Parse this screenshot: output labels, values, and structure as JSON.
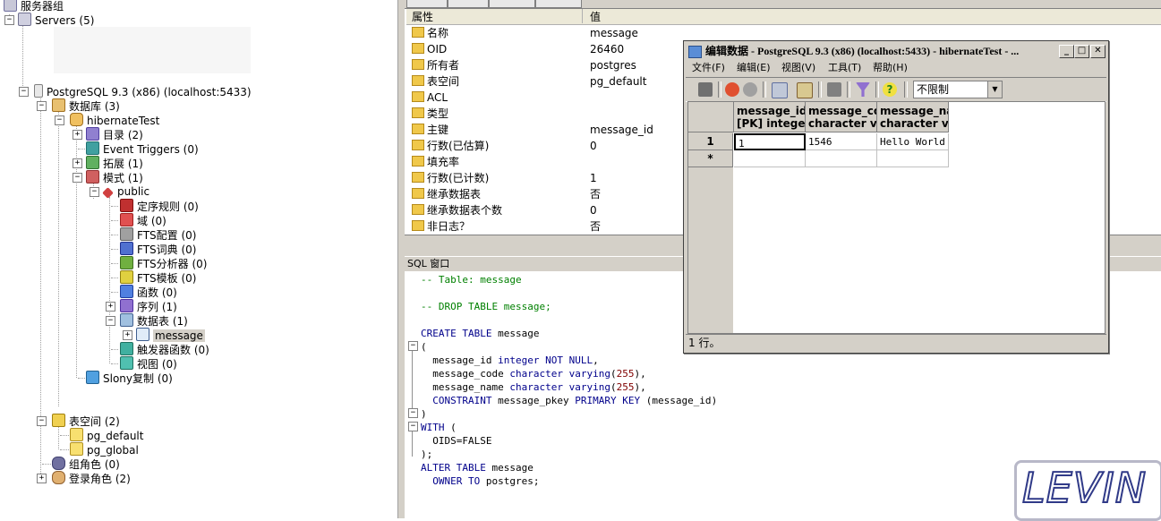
{
  "tree": {
    "server_group": "服务器组",
    "servers": "Servers (5)",
    "server": "PostgreSQL 9.3 (x86) (localhost:5433)",
    "databases": "数据库 (3)",
    "db": "hibernateTest",
    "catalogs": "目录 (2)",
    "event_triggers": "Event Triggers (0)",
    "extensions": "拓展 (1)",
    "schemas": "模式 (1)",
    "schema_public": "public",
    "collations": "定序规则 (0)",
    "domains": "域 (0)",
    "fts_config": "FTS配置 (0)",
    "fts_dict": "FTS词典 (0)",
    "fts_parser": "FTS分析器 (0)",
    "fts_template": "FTS模板 (0)",
    "functions": "函数 (0)",
    "sequences": "序列 (1)",
    "tables": "数据表 (1)",
    "table_message": "message",
    "trigger_functions": "触发器函数 (0)",
    "views": "视图 (0)",
    "slony": "Slony复制 (0)",
    "tablespaces": "表空间 (2)",
    "pg_default": "pg_default",
    "pg_global": "pg_global",
    "group_roles": "组角色 (0)",
    "login_roles": "登录角色 (2)"
  },
  "props": {
    "col_property": "属性",
    "col_value": "值",
    "rows": [
      {
        "k": "名称",
        "v": "message"
      },
      {
        "k": "OID",
        "v": "26460"
      },
      {
        "k": "所有者",
        "v": "postgres"
      },
      {
        "k": "表空间",
        "v": "pg_default"
      },
      {
        "k": "ACL",
        "v": ""
      },
      {
        "k": "类型",
        "v": ""
      },
      {
        "k": "主键",
        "v": "message_id"
      },
      {
        "k": "行数(已估算)",
        "v": "0"
      },
      {
        "k": "填充率",
        "v": ""
      },
      {
        "k": "行数(已计数)",
        "v": "1"
      },
      {
        "k": "继承数据表",
        "v": "否"
      },
      {
        "k": "继承数据表个数",
        "v": "0"
      },
      {
        "k": "非日志？",
        "v": "否"
      }
    ]
  },
  "sql": {
    "title": "SQL 窗口",
    "lines": [
      "-- Table: message",
      "",
      "-- DROP TABLE message;",
      "",
      "CREATE TABLE message",
      "(",
      "  message_id integer NOT NULL,",
      "  message_code character varying(255),",
      "  message_name character varying(255),",
      "  CONSTRAINT message_pkey PRIMARY KEY (message_id)",
      ")",
      "WITH (",
      "  OIDS=FALSE",
      ");",
      "ALTER TABLE message",
      "  OWNER TO postgres;"
    ]
  },
  "editwin": {
    "title": "编辑数据 - PostgreSQL 9.3 (x86) (localhost:5433) - hibernateTest - ...",
    "menus": [
      "文件(F)",
      "编辑(E)",
      "视图(V)",
      "工具(T)",
      "帮助(H)"
    ],
    "limit": "不限制",
    "columns": [
      {
        "l1": "message_id",
        "l2": "[PK] integer"
      },
      {
        "l1": "message_co",
        "l2": "character va"
      },
      {
        "l1": "message_na",
        "l2": "character va"
      }
    ],
    "rows": [
      {
        "num": "1",
        "cells": [
          "1",
          "1546",
          "Hello World"
        ]
      },
      {
        "num": "*",
        "cells": [
          "",
          "",
          ""
        ]
      }
    ],
    "status": "1 行。",
    "btn_min": "_",
    "btn_max": "□",
    "btn_close": "✕"
  },
  "watermark": "LEVIN"
}
